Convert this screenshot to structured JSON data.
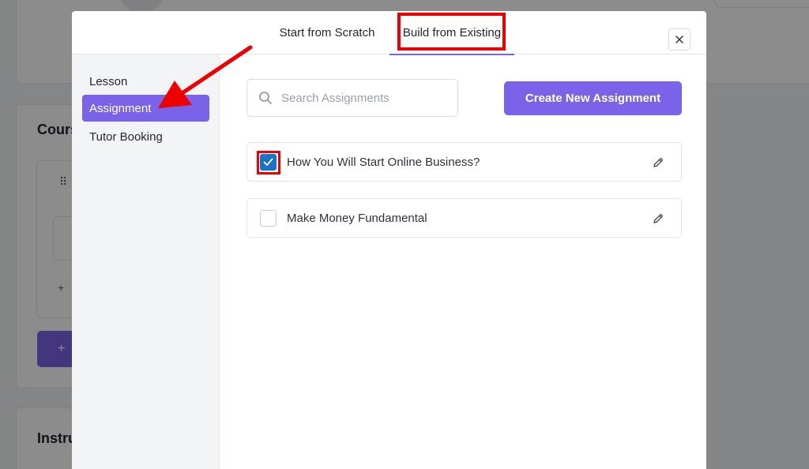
{
  "background": {
    "course_section_title_partial": "Cours",
    "instructor_section_title_partial": "Instru",
    "add_button_partial": "+"
  },
  "modal": {
    "tabs": [
      {
        "label": "Start from Scratch",
        "active": false
      },
      {
        "label": "Build from Existing",
        "active": true
      }
    ],
    "close_icon": "close-icon",
    "sidebar": {
      "items": [
        {
          "label": "Lesson",
          "active": false
        },
        {
          "label": "Assignment",
          "active": true
        },
        {
          "label": "Tutor Booking",
          "active": false
        }
      ]
    },
    "search": {
      "placeholder": "Search Assignments",
      "value": ""
    },
    "create_button_label": "Create New Assignment",
    "assignments": [
      {
        "title": "How You Will Start Online Business?",
        "checked": true
      },
      {
        "title": "Make Money Fundamental",
        "checked": false
      }
    ]
  },
  "colors": {
    "accent": "#7a63e8",
    "checkbox_checked": "#1b73c8",
    "annotation_red": "#ee0000"
  }
}
